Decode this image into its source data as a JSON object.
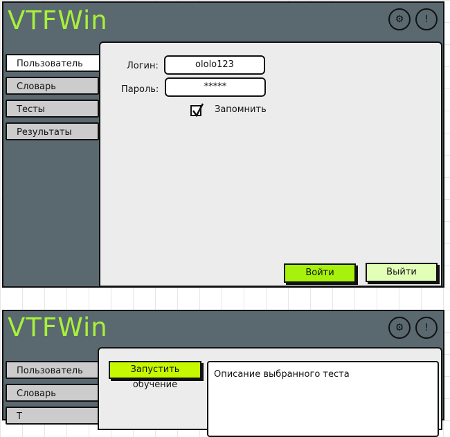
{
  "screen1": {
    "app_title": "VTFWin",
    "top_buttons": [
      {
        "icon": "gear-icon",
        "glyph": "⚙"
      },
      {
        "icon": "info-icon",
        "glyph": "!"
      }
    ],
    "tabs": [
      {
        "label": "Пользователь",
        "active": true
      },
      {
        "label": "Словарь",
        "active": false
      },
      {
        "label": "Тесты",
        "active": false
      },
      {
        "label": "Результаты",
        "active": false
      }
    ],
    "form": {
      "login_label": "Логин:",
      "login_value": "ololo123",
      "password_label": "Пароль:",
      "password_value": "*****",
      "remember_label": "Запомнить",
      "remember_checked": true
    },
    "buttons": {
      "login": "Войти",
      "exit": "Выйти"
    }
  },
  "screen2": {
    "app_title": "VTFWin",
    "top_buttons": [
      {
        "icon": "gear-icon",
        "glyph": "⚙"
      },
      {
        "icon": "info-icon",
        "glyph": "!"
      }
    ],
    "tabs": [
      {
        "label": "Пользователь",
        "active": false
      },
      {
        "label": "Словарь",
        "active": false
      },
      {
        "label": "Т",
        "active": false
      }
    ],
    "start_button": "Запустить обучение",
    "description": "Описание выбранного теста"
  },
  "colors": {
    "window_bg": "#5a6870",
    "title_green": "#a6f23a",
    "panel_bg": "#ececec",
    "tab_bg": "#cccccc",
    "login_button": "#a6f20c",
    "exit_button": "#e2ffb8",
    "start_button": "#c6f800"
  }
}
